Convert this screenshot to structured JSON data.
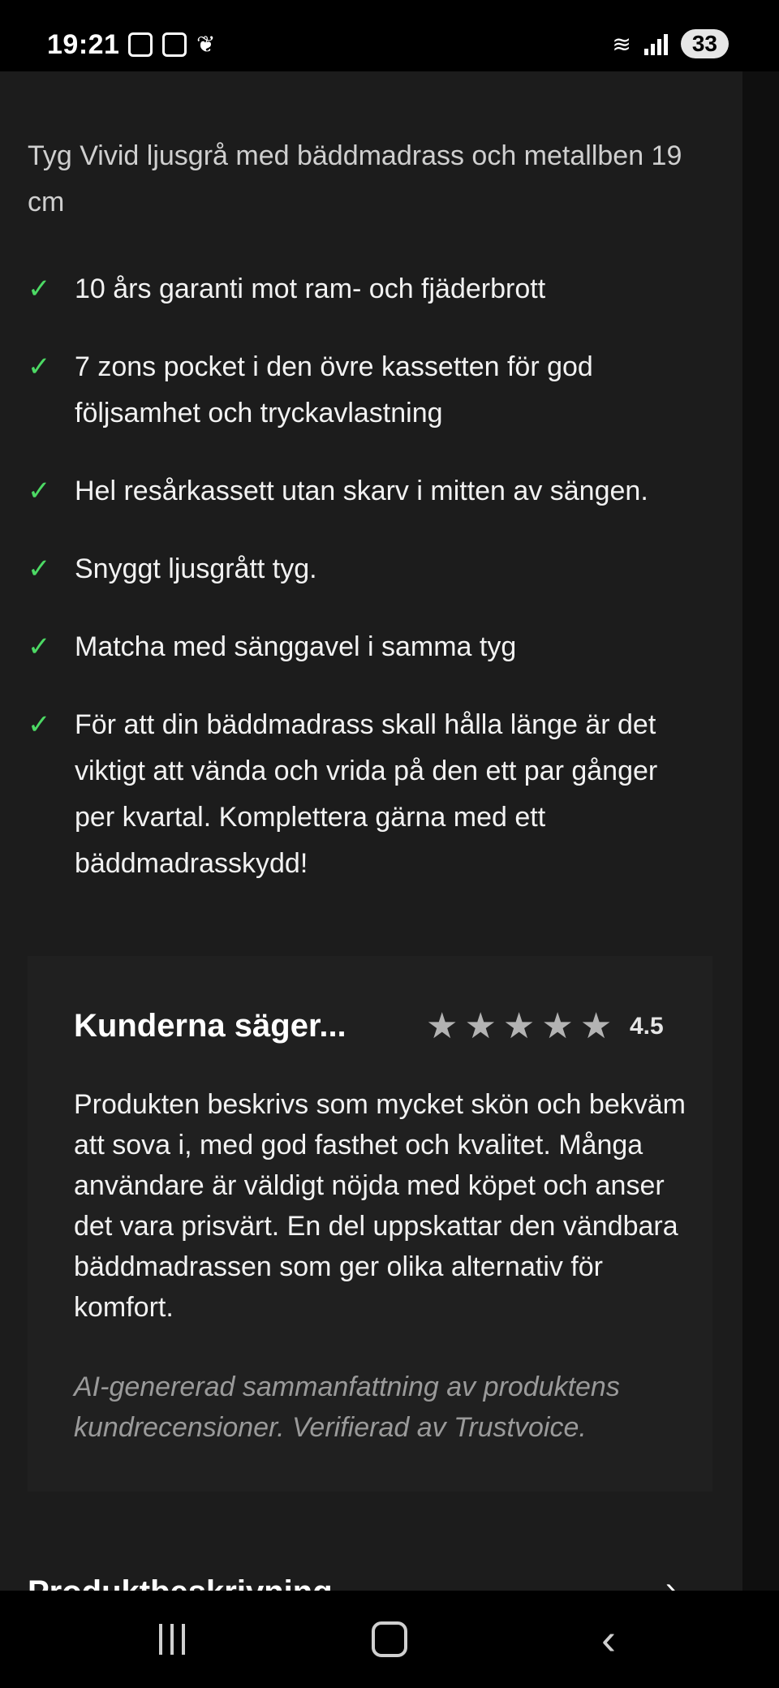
{
  "status_bar": {
    "time": "19:21",
    "wifi_label": "5",
    "battery": "33"
  },
  "product": {
    "subtitle": "Tyg Vivid ljusgrå med bäddmadrass och metallben 19 cm",
    "features": [
      "10 års garanti mot ram- och fjäderbrott",
      "7 zons pocket i den övre kassetten för god följsamhet och tryckavlastning",
      "Hel resårkassett utan skarv i mitten av sängen.",
      "Snyggt ljusgrått tyg.",
      "Matcha med sänggavel i samma tyg",
      "För att din bäddmadrass skall hålla länge är det viktigt att vända och vrida på den ett par gånger per kvartal. Komplettera gärna med ett bäddmadrasskydd!"
    ]
  },
  "review": {
    "title": "Kunderna säger...",
    "stars": 5,
    "rating": "4.5",
    "body": "Produkten beskrivs som mycket skön och bekväm att sova i, med god fasthet och kvalitet. Många användare är väldigt nöjda med köpet och anser det vara prisvärt. En del uppskattar den vändbara bäddmadrassen som ger olika alternativ för komfort.",
    "note": "AI-genererad sammanfattning av produktens kundrecensioner. Verifierad av Trustvoice."
  },
  "next_section": {
    "heading": "Produktbeskrivning"
  },
  "colors": {
    "background": "#1c1c1c",
    "check": "#4cd964",
    "star": "#b3b3b3"
  }
}
